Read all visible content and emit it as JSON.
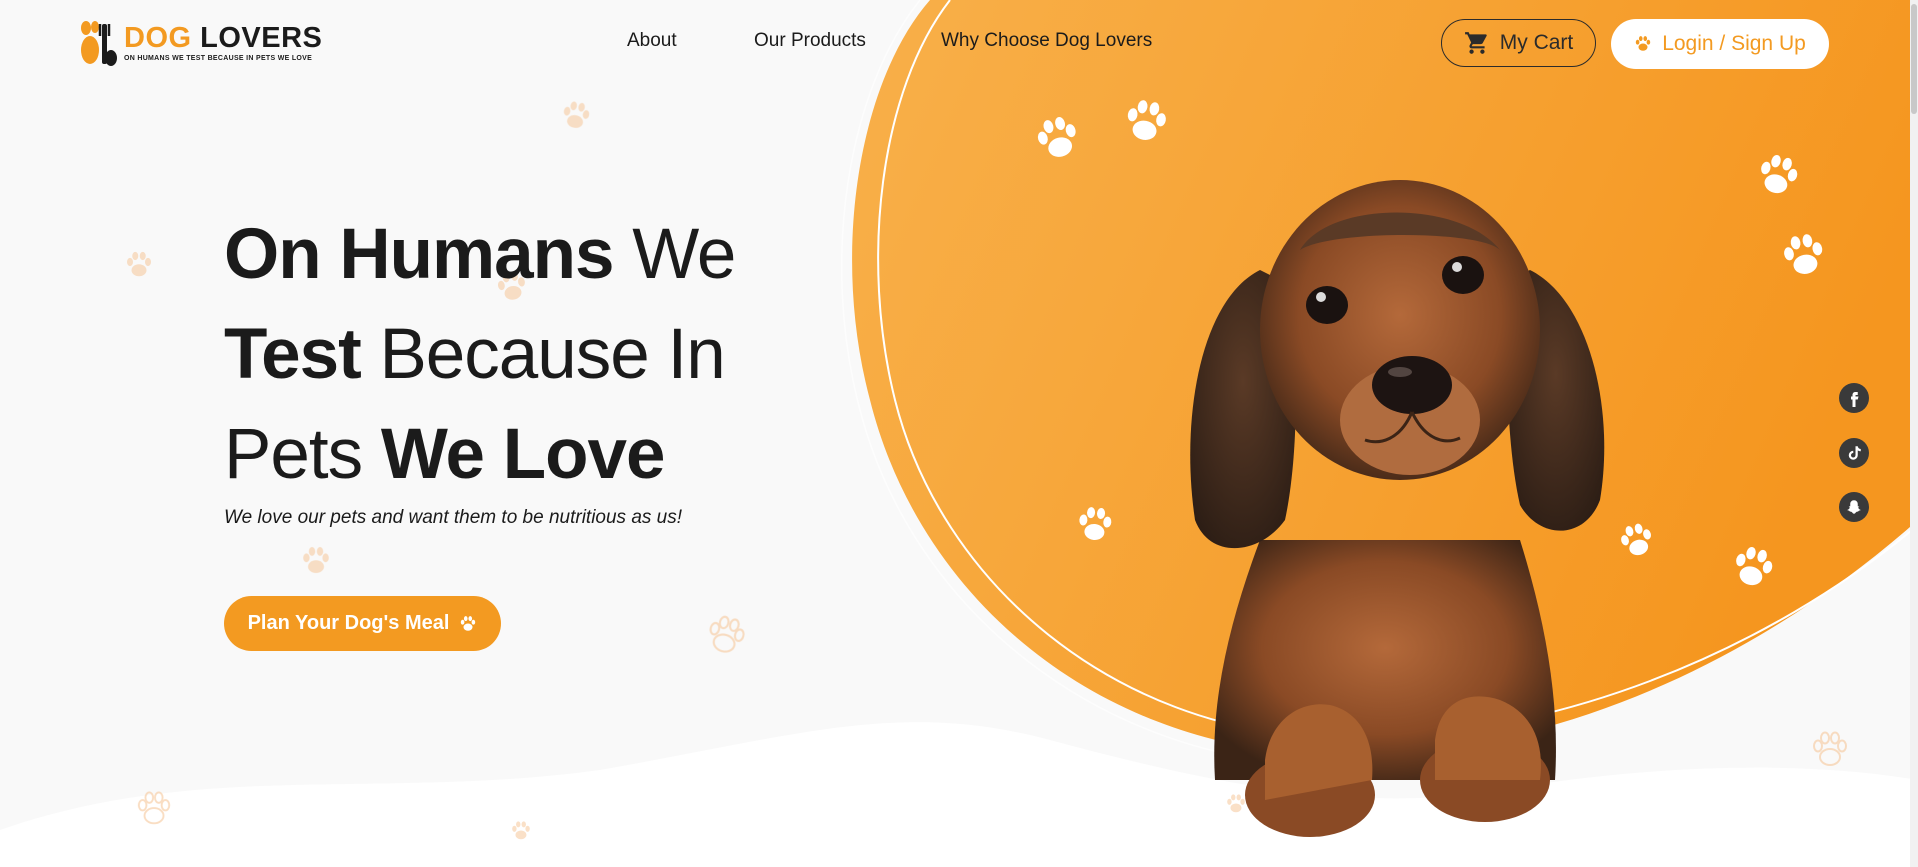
{
  "brand": {
    "name_part1": "DOG",
    "name_part2": "LOVERS",
    "tagline": "ON HUMANS WE TEST BECAUSE IN PETS WE LOVE",
    "accent": "#f39a21"
  },
  "nav": {
    "items": [
      {
        "label": "About"
      },
      {
        "label": "Our Products"
      },
      {
        "label": "Why Choose Dog Lovers"
      }
    ]
  },
  "header": {
    "cart_label": "My Cart",
    "cart_icon": "cart-icon",
    "login_label": "Login / Sign Up",
    "login_icon": "paw-icon"
  },
  "hero": {
    "line1_bold": "On Humans",
    "line1_light": "We",
    "line2_bold": "Test",
    "line2_light": "Because In",
    "line3_light": "Pets",
    "line3_bold": "We Love",
    "subtitle": "We love our pets and want them to be nutritious as us!",
    "cta_label": "Plan Your Dog's Meal",
    "cta_icon": "paw-icon"
  },
  "social": {
    "icons": [
      "facebook-icon",
      "tiktok-icon",
      "snapchat-icon"
    ]
  }
}
